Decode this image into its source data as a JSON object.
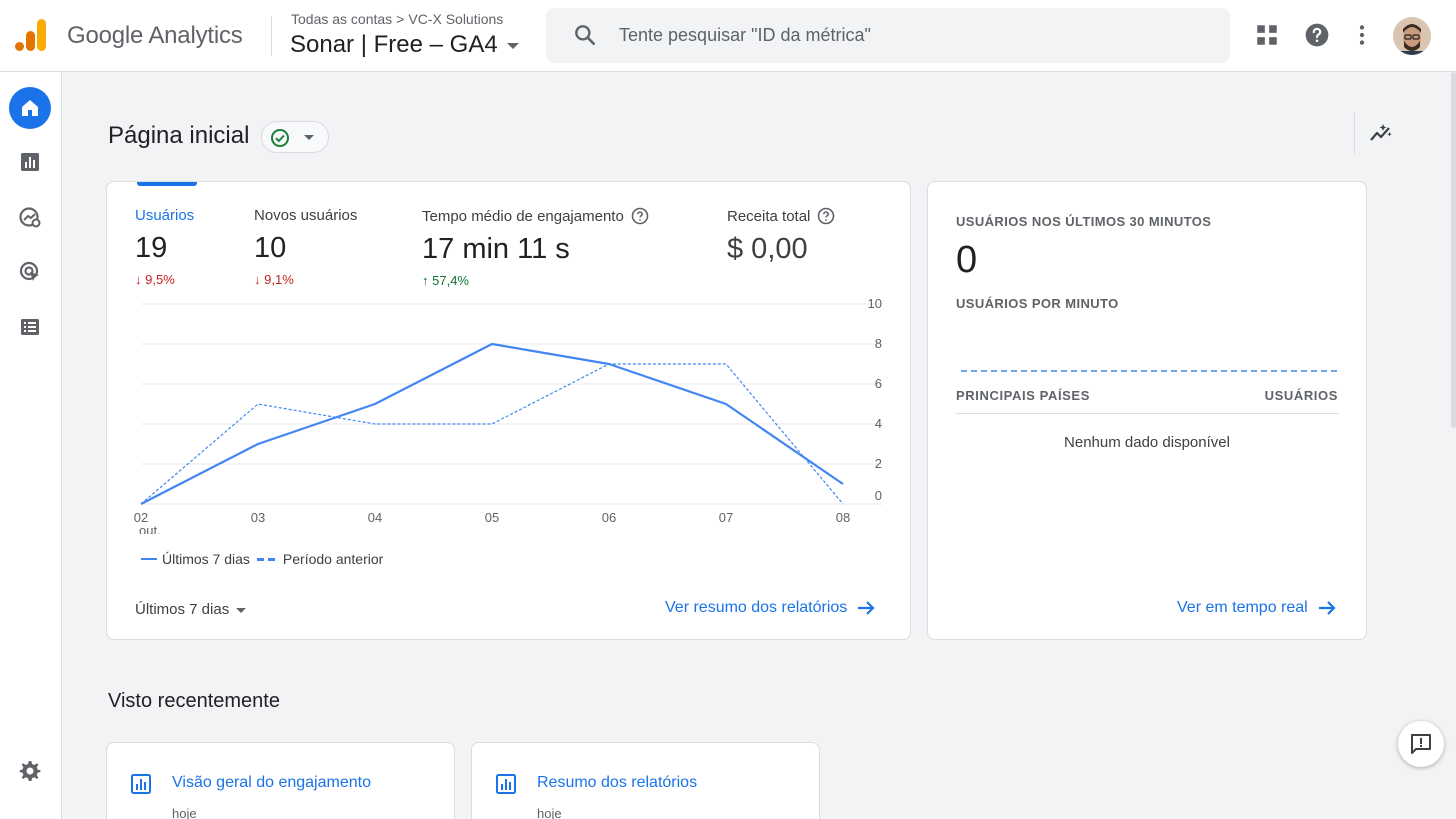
{
  "header": {
    "brand": "Google Analytics",
    "breadcrumb": {
      "all_accounts": "Todas as contas",
      "separator": ">",
      "account": "VC-X Solutions"
    },
    "property": "Sonar | Free – GA4",
    "search_placeholder": "Tente pesquisar \"ID da métrica\"",
    "icons": [
      "apps-grid-icon",
      "help-icon",
      "more-vert-icon"
    ]
  },
  "nav": {
    "items": [
      {
        "icon": "home-icon",
        "active": true
      },
      {
        "icon": "reports-icon",
        "active": false
      },
      {
        "icon": "explore-icon",
        "active": false
      },
      {
        "icon": "advertising-icon",
        "active": false
      },
      {
        "icon": "configure-icon",
        "active": false
      }
    ],
    "settings_icon": "settings-gear-icon"
  },
  "page": {
    "title": "Página inicial"
  },
  "overview": {
    "metrics": [
      {
        "label": "Usuários",
        "value": "19",
        "change": "9,5%",
        "direction": "down",
        "selected": true
      },
      {
        "label": "Novos usuários",
        "value": "10",
        "change": "9,1%",
        "direction": "down",
        "selected": false
      },
      {
        "label": "Tempo médio de engajamento",
        "value": "17 min 11 s",
        "change": "57,4%",
        "direction": "up",
        "selected": false
      },
      {
        "label": "Receita total",
        "value": "$ 0,00",
        "change": "",
        "direction": "none",
        "selected": false
      }
    ],
    "legend": {
      "current": "Últimos 7 dias",
      "previous": "Período anterior"
    },
    "range_label": "Últimos 7 dias",
    "link_label": "Ver resumo dos relatórios"
  },
  "chart_data": {
    "type": "line",
    "x": [
      "02",
      "03",
      "04",
      "05",
      "06",
      "07",
      "08"
    ],
    "x_sublabel": "out.",
    "yticks": [
      0,
      2,
      4,
      6,
      8,
      10
    ],
    "ylim": [
      0,
      10
    ],
    "grid": true,
    "legend_position": "bottom-left",
    "series": [
      {
        "name": "Últimos 7 dias",
        "style": "solid",
        "color": "#4285f4",
        "values": [
          0,
          3,
          5,
          8,
          7,
          5,
          1
        ]
      },
      {
        "name": "Período anterior",
        "style": "dashed",
        "color": "#4285f4",
        "values": [
          0,
          5,
          4,
          4,
          7,
          7,
          0
        ]
      }
    ]
  },
  "realtime": {
    "title": "USUÁRIOS NOS ÚLTIMOS 30 MINUTOS",
    "value": "0",
    "subtitle": "USUÁRIOS POR MINUTO",
    "col_country": "PRINCIPAIS PAÍSES",
    "col_users": "USUÁRIOS",
    "empty": "Nenhum dado disponível",
    "link_label": "Ver em tempo real"
  },
  "recent": {
    "title": "Visto recentemente",
    "items": [
      {
        "title": "Visão geral do engajamento",
        "date": "hoje"
      },
      {
        "title": "Resumo dos relatórios",
        "date": "hoje"
      }
    ]
  },
  "colors": {
    "accent": "#1a73e8",
    "down": "#c5221f",
    "up": "#137333",
    "line": "#4285f4"
  }
}
